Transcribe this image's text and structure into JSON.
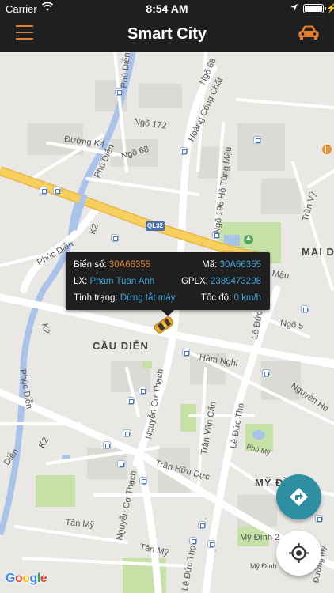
{
  "status_bar": {
    "carrier": "Carrier",
    "time": "8:54 AM",
    "charging_symbol": "⚡"
  },
  "nav": {
    "title": "Smart City",
    "menu_icon": "hamburger-menu-icon",
    "right_icon": "car-icon"
  },
  "vehicle_info": {
    "plate_label": "Biển số:",
    "plate_value": "30A66355",
    "code_label": "Mã:",
    "code_value": "30A66355",
    "driver_label": "LX:",
    "driver_value": "Pham Tuan Anh",
    "license_label": "GPLX:",
    "license_value": "2389473298",
    "status_label": "Tình trạng:",
    "status_value": "Dừng tắt máy",
    "speed_label": "Tốc độ:",
    "speed_value": "0 km/h"
  },
  "map_labels": {
    "ngo68_top": "Ngõ 68",
    "phu_dien_1": "Phú Diễn",
    "hoang_cong_chat": "Hoàng Công Chất",
    "ngo172": "Ngõ 172",
    "duong_k4": "Đường K4",
    "phu_dien_2": "Phú Diễn",
    "ngo68_mid": "Ngõ 68",
    "ngo196": "Ngõ 196 Hồ Tùng Mậu",
    "tran_vy": "Trần Vỹ",
    "k2_top": "K2",
    "ql32": "QL32",
    "phuc_dien_1": "Phúc Diễn",
    "mai_d": "MAI D",
    "mau": "Mậu",
    "ngo5": "Ngõ 5",
    "phuc_dien_2": "Phúc Diễn",
    "k2_left": "K2",
    "cau_dien": "CẦU DIỄN",
    "le_duc_tho_1": "Lê Đức Thọ",
    "ham_nghi": "Hàm Nghi",
    "nguyen_co_thach_1": "Nguyễn Cơ Thạch",
    "tran_van_can": "Trần Văn Cẩn",
    "le_duc_tho_2": "Lê Đức Thọ",
    "nguyen_ho": "Nguyễn Ho",
    "k2_bottom": "K2",
    "phu_my": "Phú Mỹ",
    "dien": "Diễn",
    "tran_huu_duc": "Trần Hữu Dực",
    "nguyen_co_thach_2": "Nguyễn Cơ Thạch",
    "my_dinh": "MỸ ĐÌNH",
    "tan_my_1": "Tân Mỹ",
    "my_dinh_2": "Mỹ Đình 2",
    "tan_my_2": "Tân Mỹ",
    "duong_my": "Đường Mỹ",
    "my_dinh_small": "Mỹ Đình",
    "le_duc_tho_3": "Lê Đức Thọ"
  },
  "google_logo": {
    "letters": [
      "G",
      "o",
      "o",
      "g",
      "l",
      "e"
    ],
    "colors": [
      "#4285F4",
      "#EA4335",
      "#FBBC05",
      "#4285F4",
      "#34A853",
      "#EA4335"
    ]
  },
  "buttons": {
    "route_icon": "directions-icon",
    "locate_icon": "my-location-icon"
  },
  "colors": {
    "bar_bg": "#1f1f1f",
    "accent_orange": "#e5812d",
    "value_blue": "#3ea6d9",
    "fab_teal": "#2e8fa3",
    "river_blue": "#a9c3ea",
    "highway_yellow": "#f6cf5c"
  }
}
